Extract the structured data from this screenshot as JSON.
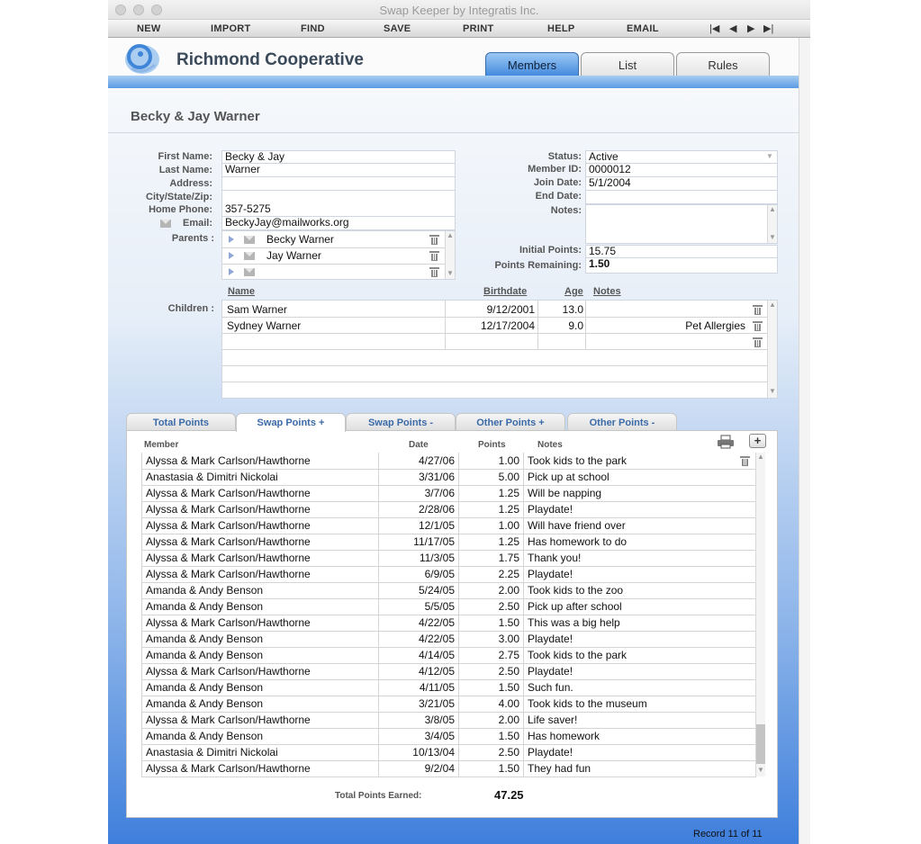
{
  "window": {
    "title": "Swap Keeper by Integratis Inc."
  },
  "menu": {
    "items": [
      "NEW",
      "IMPORT",
      "FIND",
      "SAVE",
      "PRINT",
      "HELP",
      "EMAIL"
    ],
    "nav": [
      "|◀",
      "◀",
      "▶",
      "▶|"
    ]
  },
  "header": {
    "org_name": "Richmond Cooperative",
    "tabs": [
      {
        "label": "Members",
        "active": true
      },
      {
        "label": "List",
        "active": false
      },
      {
        "label": "Rules",
        "active": false
      }
    ]
  },
  "member": {
    "display_name": "Becky & Jay Warner",
    "labels": {
      "first_name": "First Name:",
      "last_name": "Last Name:",
      "address": "Address:",
      "city_state_zip": "City/State/Zip:",
      "home_phone": "Home Phone:",
      "email": "Email:",
      "parents": "Parents :",
      "status": "Status:",
      "member_id": "Member ID:",
      "join_date": "Join Date:",
      "end_date": "End Date:",
      "notes": "Notes:",
      "initial_points": "Initial Points:",
      "points_remaining": "Points Remaining:",
      "children": "Children :"
    },
    "first_name": "Becky & Jay",
    "last_name": "Warner",
    "address": "",
    "city_state_zip": "",
    "home_phone": "357-5275",
    "email": "BeckyJay@mailworks.org",
    "parents": [
      "Becky Warner",
      "Jay Warner",
      ""
    ],
    "status": "Active",
    "member_id": "0000012",
    "join_date": "5/1/2004",
    "end_date": "",
    "notes": "",
    "initial_points": "15.75",
    "points_remaining": "1.50"
  },
  "children": {
    "headers": {
      "name": "Name",
      "birthdate": "Birthdate",
      "age": "Age",
      "notes": "Notes"
    },
    "rows": [
      {
        "name": "Sam Warner",
        "birthdate": "9/12/2001",
        "age": "13.0",
        "notes": ""
      },
      {
        "name": "Sydney Warner",
        "birthdate": "12/17/2004",
        "age": "9.0",
        "notes": "Pet Allergies"
      }
    ]
  },
  "points_tabs": [
    {
      "label": "Total Points",
      "active": false
    },
    {
      "label": "Swap Points +",
      "active": true
    },
    {
      "label": "Swap Points -",
      "active": false
    },
    {
      "label": "Other Points +",
      "active": false
    },
    {
      "label": "Other Points -",
      "active": false
    }
  ],
  "swaps": {
    "headers": {
      "member": "Member",
      "date": "Date",
      "points": "Points",
      "notes": "Notes"
    },
    "add_label": "+",
    "rows": [
      {
        "member": "Alyssa & Mark Carlson/Hawthorne",
        "date": "4/27/06",
        "points": "1.00",
        "notes": "Took kids to the park"
      },
      {
        "member": "Anastasia & Dimitri Nickolai",
        "date": "3/31/06",
        "points": "5.00",
        "notes": "Pick up at school"
      },
      {
        "member": "Alyssa & Mark Carlson/Hawthorne",
        "date": "3/7/06",
        "points": "1.25",
        "notes": "Will be napping"
      },
      {
        "member": "Alyssa & Mark Carlson/Hawthorne",
        "date": "2/28/06",
        "points": "1.25",
        "notes": "Playdate!"
      },
      {
        "member": "Alyssa & Mark Carlson/Hawthorne",
        "date": "12/1/05",
        "points": "1.00",
        "notes": "Will have friend over"
      },
      {
        "member": "Alyssa & Mark Carlson/Hawthorne",
        "date": "11/17/05",
        "points": "1.25",
        "notes": "Has homework to do"
      },
      {
        "member": "Alyssa & Mark Carlson/Hawthorne",
        "date": "11/3/05",
        "points": "1.75",
        "notes": "Thank you!"
      },
      {
        "member": "Alyssa & Mark Carlson/Hawthorne",
        "date": "6/9/05",
        "points": "2.25",
        "notes": "Playdate!"
      },
      {
        "member": "Amanda & Andy Benson",
        "date": "5/24/05",
        "points": "2.00",
        "notes": "Took kids to the zoo"
      },
      {
        "member": "Amanda & Andy Benson",
        "date": "5/5/05",
        "points": "2.50",
        "notes": "Pick up after school"
      },
      {
        "member": "Alyssa & Mark Carlson/Hawthorne",
        "date": "4/22/05",
        "points": "1.50",
        "notes": "This was a big help"
      },
      {
        "member": "Amanda & Andy Benson",
        "date": "4/22/05",
        "points": "3.00",
        "notes": "Playdate!"
      },
      {
        "member": "Amanda & Andy Benson",
        "date": "4/14/05",
        "points": "2.75",
        "notes": "Took kids to the park"
      },
      {
        "member": "Alyssa & Mark Carlson/Hawthorne",
        "date": "4/12/05",
        "points": "2.50",
        "notes": "Playdate!"
      },
      {
        "member": "Amanda & Andy Benson",
        "date": "4/11/05",
        "points": "1.50",
        "notes": "Such fun."
      },
      {
        "member": "Amanda & Andy Benson",
        "date": "3/21/05",
        "points": "4.00",
        "notes": "Took kids to the museum"
      },
      {
        "member": "Alyssa & Mark Carlson/Hawthorne",
        "date": "3/8/05",
        "points": "2.00",
        "notes": "Life saver!"
      },
      {
        "member": "Amanda & Andy Benson",
        "date": "3/4/05",
        "points": "1.50",
        "notes": "Has homework"
      },
      {
        "member": "Anastasia & Dimitri Nickolai",
        "date": "10/13/04",
        "points": "2.50",
        "notes": "Playdate!"
      },
      {
        "member": "Alyssa & Mark Carlson/Hawthorne",
        "date": "9/2/04",
        "points": "1.50",
        "notes": "They had fun"
      }
    ],
    "total_label": "Total Points Earned:",
    "total_value": "47.25"
  },
  "footer": {
    "record": "Record 11 of 11"
  },
  "colors": {
    "accent": "#3d86dc",
    "tab_text": "#3b6aa8",
    "gradient_bottom": "#3f7fdc"
  },
  "icons": [
    "logo-icon",
    "envelope-icon",
    "trash-icon",
    "printer-icon",
    "expand-triangle-icon"
  ]
}
